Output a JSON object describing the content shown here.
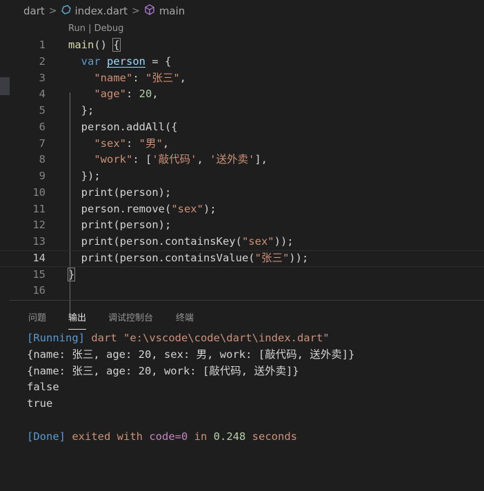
{
  "breadcrumb": {
    "folder": "dart",
    "file": "index.dart",
    "symbol": "main"
  },
  "codelens": {
    "run": "Run",
    "separator": " | ",
    "debug": "Debug"
  },
  "editor": {
    "line_numbers": [
      "1",
      "2",
      "3",
      "4",
      "5",
      "6",
      "7",
      "8",
      "9",
      "10",
      "11",
      "12",
      "13",
      "14",
      "15",
      "16"
    ],
    "current_line": 14,
    "lines": [
      [
        [
          "fn",
          "main"
        ],
        [
          "p",
          "() "
        ],
        [
          "pb",
          "{"
        ]
      ],
      [
        [
          "p",
          "  "
        ],
        [
          "kw",
          "var"
        ],
        [
          "p",
          " "
        ],
        [
          "var",
          "person"
        ],
        [
          "p",
          " = {"
        ]
      ],
      [
        [
          "p",
          "    "
        ],
        [
          "str",
          "\"name\""
        ],
        [
          "p",
          ": "
        ],
        [
          "str",
          "\"张三\""
        ],
        [
          "p",
          ","
        ]
      ],
      [
        [
          "p",
          "    "
        ],
        [
          "str",
          "\"age\""
        ],
        [
          "p",
          ": "
        ],
        [
          "num",
          "20"
        ],
        [
          "p",
          ","
        ]
      ],
      [
        [
          "p",
          "  };"
        ]
      ],
      [
        [
          "p",
          "  person.addAll({"
        ]
      ],
      [
        [
          "p",
          "    "
        ],
        [
          "str",
          "\"sex\""
        ],
        [
          "p",
          ": "
        ],
        [
          "str",
          "\"男\""
        ],
        [
          "p",
          ","
        ]
      ],
      [
        [
          "p",
          "    "
        ],
        [
          "str",
          "\"work\""
        ],
        [
          "p",
          ": ["
        ],
        [
          "str",
          "'敲代码'"
        ],
        [
          "p",
          ", "
        ],
        [
          "str",
          "'送外卖'"
        ],
        [
          "p",
          "],"
        ]
      ],
      [
        [
          "p",
          "  });"
        ]
      ],
      [
        [
          "p",
          "  print(person);"
        ]
      ],
      [
        [
          "p",
          "  person.remove("
        ],
        [
          "str",
          "\"sex\""
        ],
        [
          "p",
          ");"
        ]
      ],
      [
        [
          "p",
          "  print(person);"
        ]
      ],
      [
        [
          "p",
          "  print(person.containsKey("
        ],
        [
          "str",
          "\"sex\""
        ],
        [
          "p",
          "));"
        ]
      ],
      [
        [
          "p",
          "  print(person.containsValue("
        ],
        [
          "str",
          "\"张三\""
        ],
        [
          "p",
          "));"
        ]
      ],
      [
        [
          "pb",
          "}"
        ]
      ],
      [
        [
          "p",
          ""
        ]
      ]
    ]
  },
  "panel": {
    "tabs": [
      "问题",
      "输出",
      "调试控制台",
      "终端"
    ],
    "active_tab": "输出"
  },
  "output": {
    "running_tag": "[Running]",
    "running_cmd": " dart \"e:\\vscode\\code\\dart\\index.dart\"",
    "line1": "{name: 张三, age: 20, sex: 男, work: [敲代码, 送外卖]}",
    "line2": "{name: 张三, age: 20, work: [敲代码, 送外卖]}",
    "line3": "false",
    "line4": "true",
    "done_tag": "[Done]",
    "done_text1": " exited with ",
    "done_code": "code=0",
    "done_text2": " in ",
    "done_time": "0.248",
    "done_text3": " seconds"
  },
  "colors": {
    "background": "#1e1e1e",
    "keyword": "#569cd6",
    "string": "#ce9178",
    "number": "#b5cea8",
    "function": "#dcdcaa"
  }
}
